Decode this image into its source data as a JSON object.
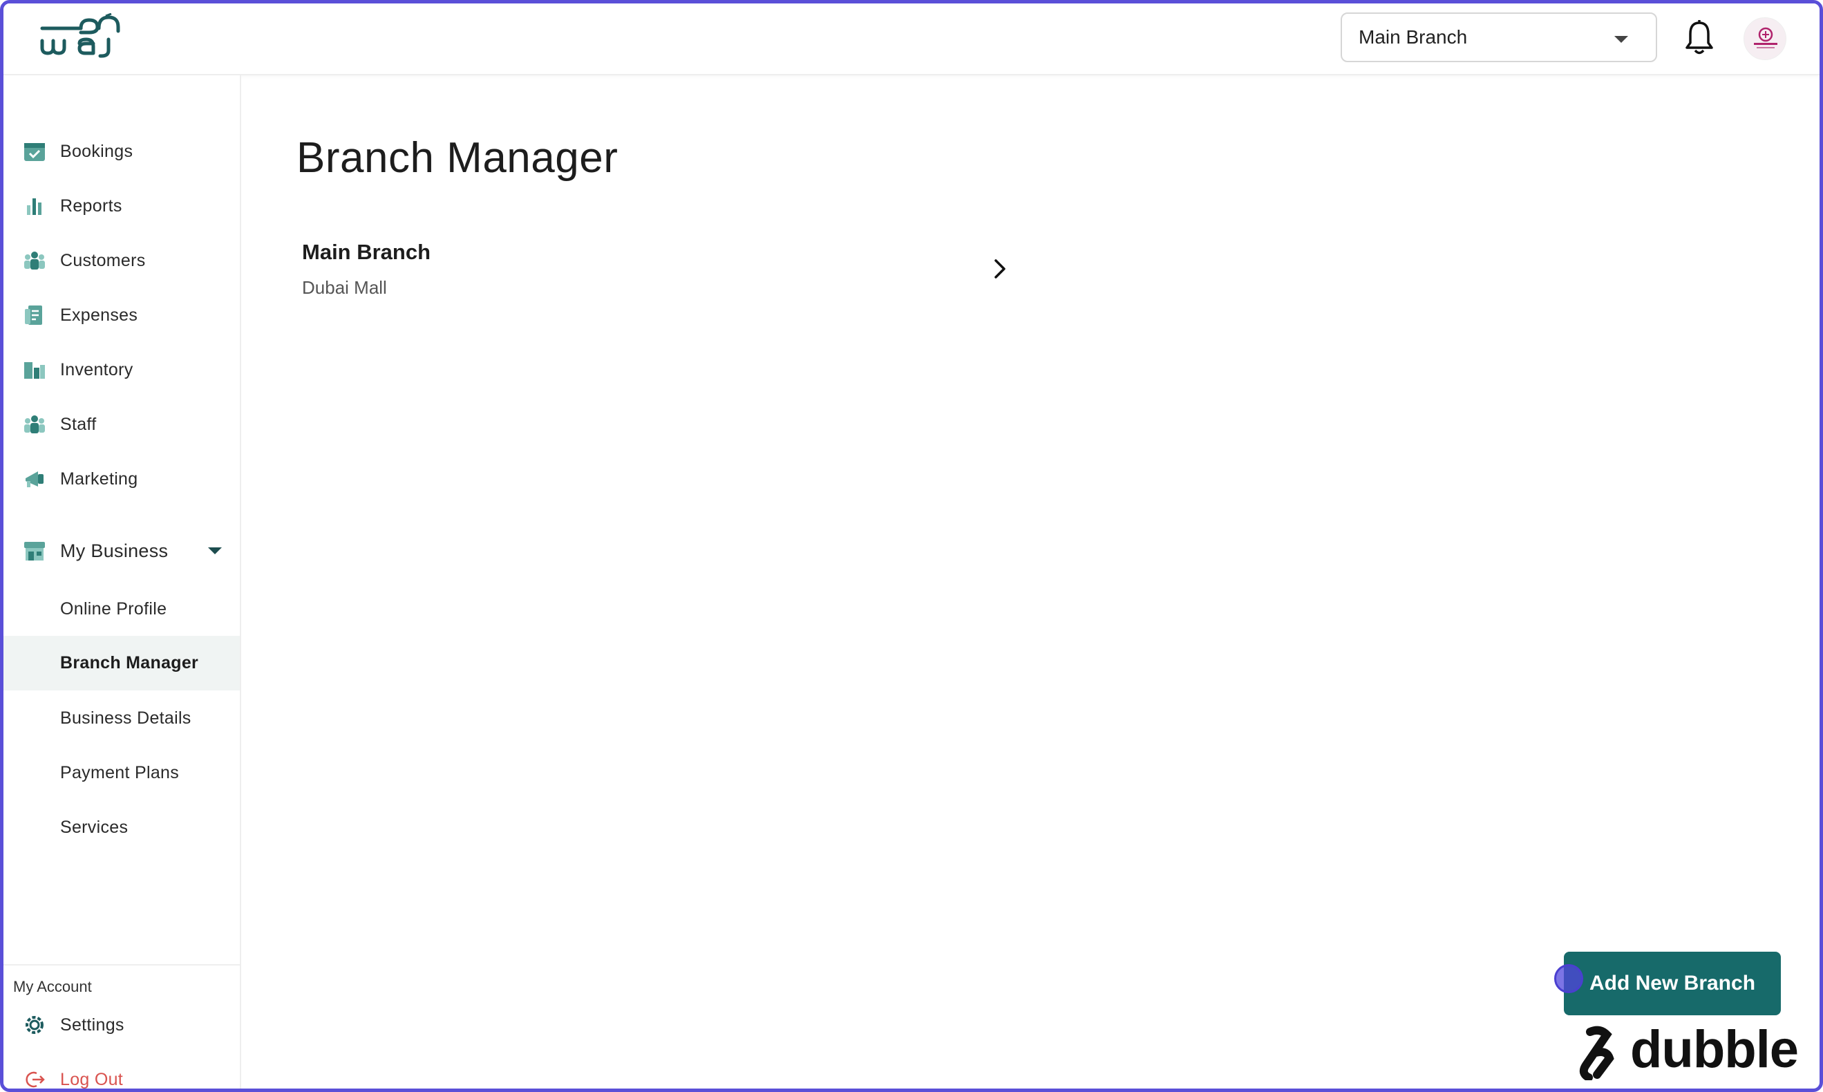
{
  "header": {
    "branch_selector": {
      "value": "Main Branch"
    }
  },
  "sidebar": {
    "items": [
      {
        "label": "Bookings",
        "icon": "calendar-check-icon"
      },
      {
        "label": "Reports",
        "icon": "bar-chart-icon"
      },
      {
        "label": "Customers",
        "icon": "users-icon"
      },
      {
        "label": "Expenses",
        "icon": "receipt-icon"
      },
      {
        "label": "Inventory",
        "icon": "boxes-icon"
      },
      {
        "label": "Staff",
        "icon": "staff-icon"
      },
      {
        "label": "Marketing",
        "icon": "megaphone-icon"
      }
    ],
    "group": {
      "label": "My Business",
      "icon": "store-icon",
      "expanded": true,
      "sub_items": [
        {
          "label": "Online Profile",
          "active": false
        },
        {
          "label": "Branch Manager",
          "active": true
        },
        {
          "label": "Business Details",
          "active": false
        },
        {
          "label": "Payment Plans",
          "active": false
        },
        {
          "label": "Services",
          "active": false
        }
      ]
    },
    "account": {
      "title": "My Account",
      "settings_label": "Settings",
      "logout_label": "Log Out"
    }
  },
  "main": {
    "title": "Branch Manager",
    "branches": [
      {
        "name": "Main Branch",
        "location": "Dubai Mall"
      }
    ],
    "add_button_label": "Add New Branch"
  },
  "watermark": {
    "text": "dubble"
  },
  "colors": {
    "accent": "#176a6a",
    "frame": "#5a4fd8",
    "icon_teal": "#5aa39a",
    "logout_red": "#d9534f",
    "active_bg": "#f0f4f3"
  }
}
